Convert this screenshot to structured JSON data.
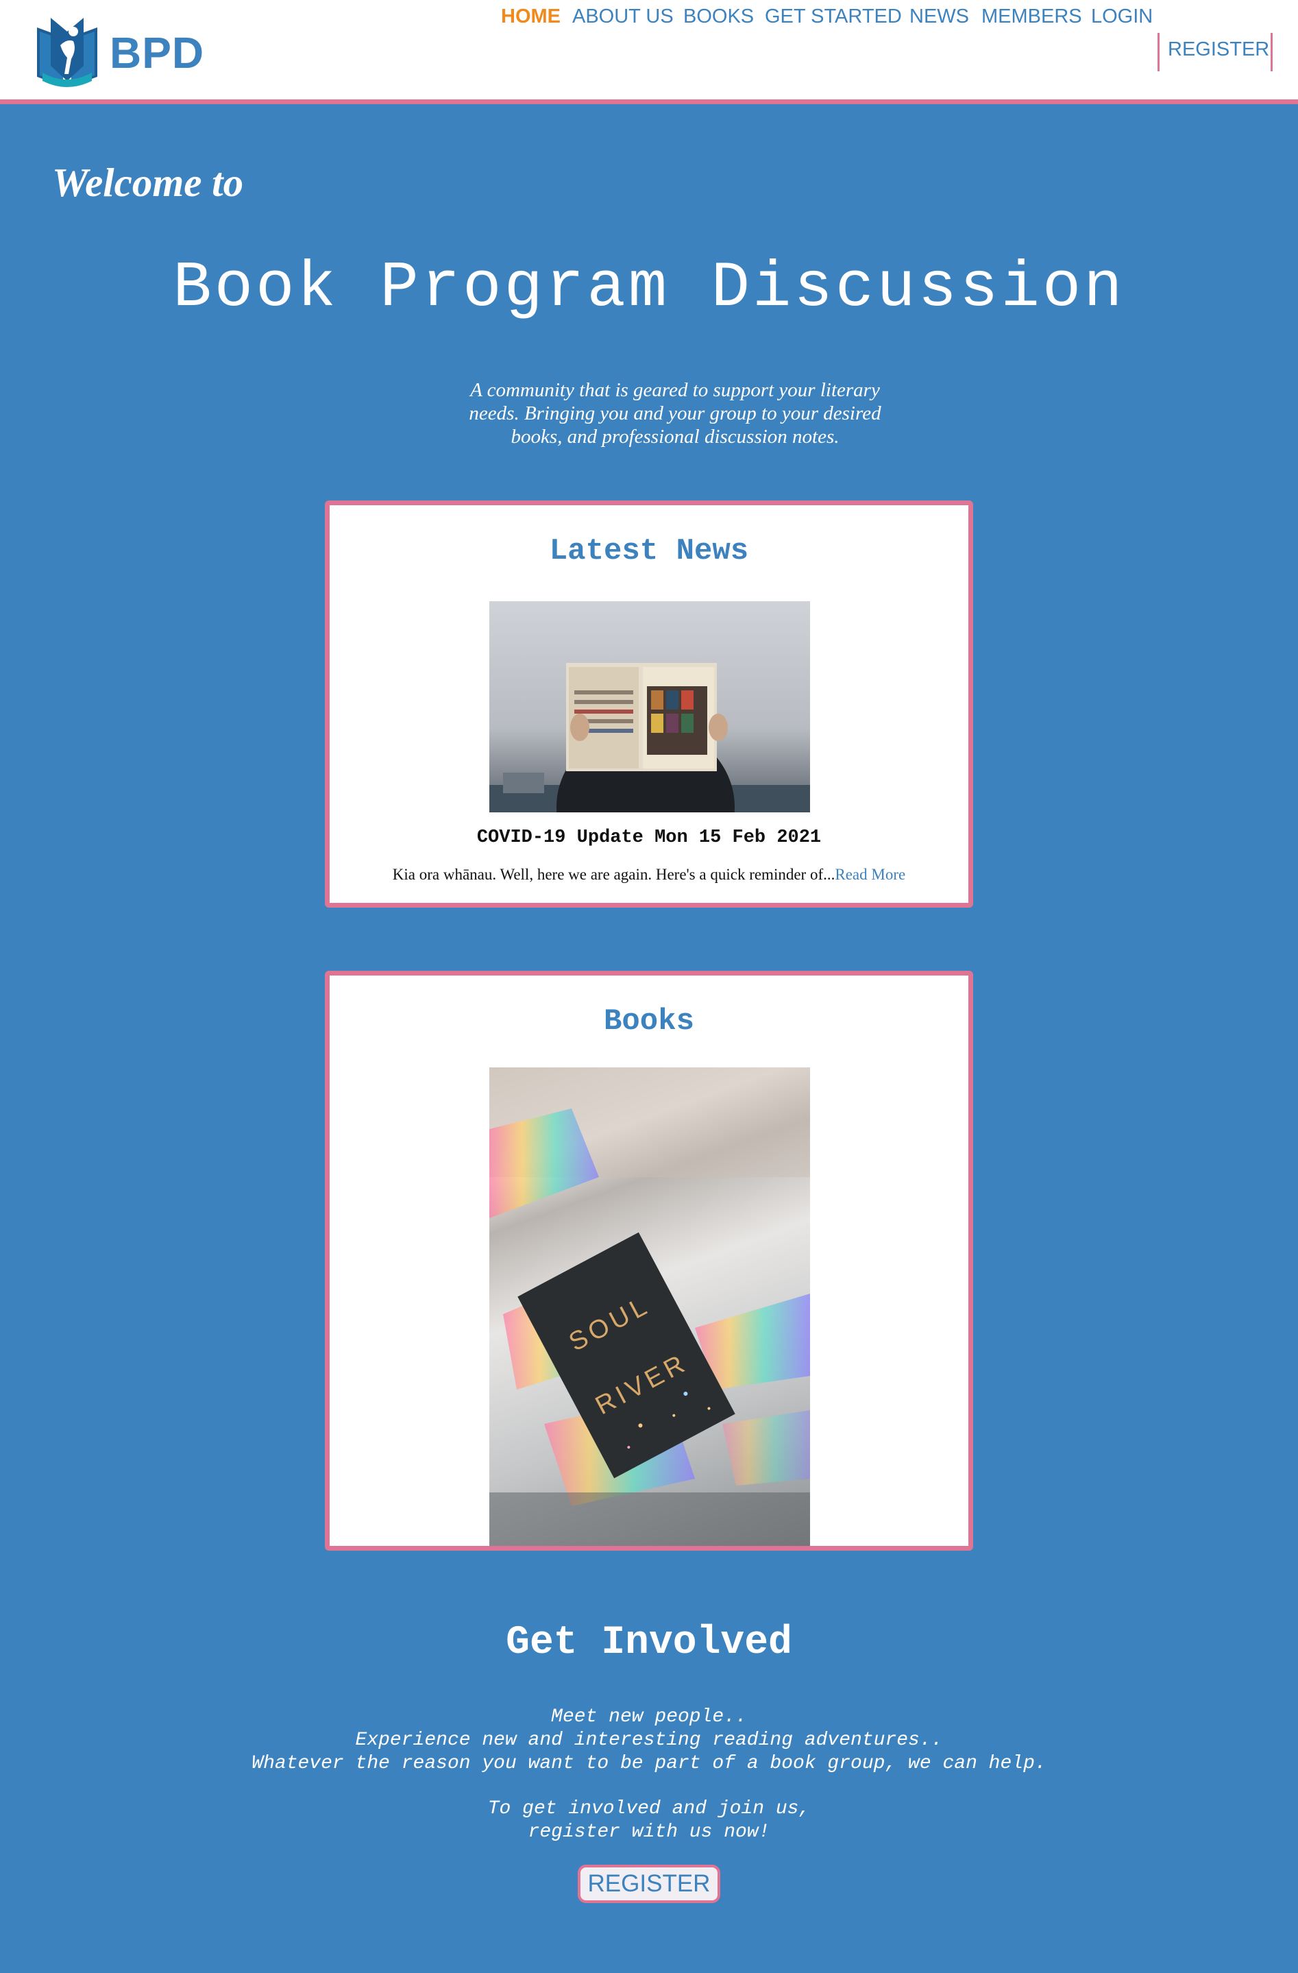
{
  "header": {
    "brand": "BPD",
    "nav": [
      {
        "label": "HOME",
        "active": true
      },
      {
        "label": "ABOUT US"
      },
      {
        "label": "BOOKS"
      },
      {
        "label": "GET STARTED"
      },
      {
        "label": "NEWS"
      },
      {
        "label": "MEMBERS"
      },
      {
        "label": "LOGIN"
      },
      {
        "label": "REGISTER"
      }
    ]
  },
  "hero": {
    "welcome": "Welcome to",
    "title": "Book Program Discussion",
    "tagline": "A community that is geared to support your literary needs. Bringing you and your group to your desired books, and professional discussion notes."
  },
  "news_card": {
    "title": "Latest News",
    "headline": "COVID-19 Update Mon 15 Feb 2021",
    "excerpt": "Kia ora whānau. Well, here we are again. Here's a quick reminder of...",
    "read_more": "Read More"
  },
  "books_card": {
    "title": "Books"
  },
  "get_involved": {
    "title": "Get Involved",
    "line1": "Meet new people..",
    "line2": "Experience new and interesting reading adventures..",
    "line3": "Whatever the reason you want to be part of a book group, we can help.",
    "line4": "To get involved and join us,",
    "line5": "register with us now!",
    "button": "REGISTER"
  },
  "colors": {
    "accent_blue": "#3c82be",
    "accent_pink": "#e07494",
    "active_orange": "#f08a1c"
  }
}
